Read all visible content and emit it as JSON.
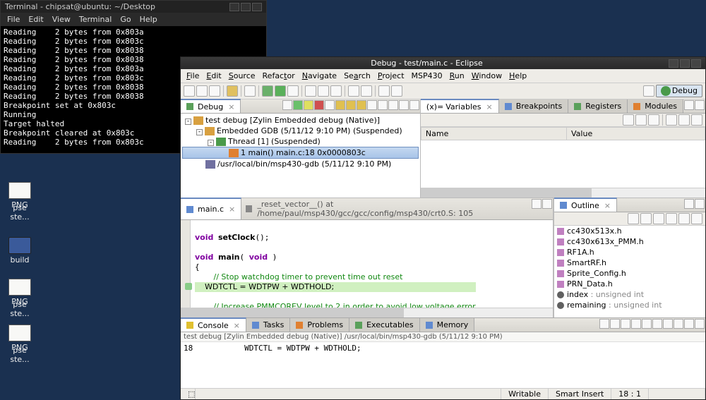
{
  "desktop_icons": [
    "PNG",
    "pse ste...",
    "build",
    "PNG",
    "pse ste...",
    "PNG",
    "pse ste..."
  ],
  "terminal": {
    "title": "Terminal - chipsat@ubuntu: ~/Desktop",
    "menu": [
      "File",
      "Edit",
      "View",
      "Terminal",
      "Go",
      "Help"
    ],
    "body": "Reading    2 bytes from 0x803a\nReading    2 bytes from 0x803c\nReading    2 bytes from 0x8038\nReading    2 bytes from 0x8038\nReading    2 bytes from 0x803a\nReading    2 bytes from 0x803c\nReading    2 bytes from 0x8038\nReading    2 bytes from 0x8038\nBreakpoint set at 0x803c\nRunning\nTarget halted\nBreakpoint cleared at 0x803c\nReading    2 bytes from 0x803c"
  },
  "eclipse": {
    "title": "Debug - test/main.c - Eclipse",
    "menu": [
      "File",
      "Edit",
      "Source",
      "Refactor",
      "Navigate",
      "Search",
      "Project",
      "MSP430",
      "Run",
      "Window",
      "Help"
    ],
    "perspective": "Debug",
    "debug_view": {
      "tab": "Debug",
      "tree": [
        {
          "l": 0,
          "exp": "-",
          "cls": "icn",
          "txt": "test debug [Zylin Embedded debug (Native)]"
        },
        {
          "l": 1,
          "exp": "-",
          "cls": "icn",
          "txt": "Embedded GDB (5/11/12 9:10 PM) (Suspended)"
        },
        {
          "l": 2,
          "exp": "-",
          "cls": "icn thr",
          "txt": "Thread [1] (Suspended)"
        },
        {
          "l": 3,
          "exp": "",
          "cls": "icn frm",
          "txt": "1 main() main.c:18 0x0000803c",
          "sel": true
        },
        {
          "l": 1,
          "exp": "",
          "cls": "icn exe",
          "txt": "/usr/local/bin/msp430-gdb (5/11/12 9:10 PM)"
        }
      ]
    },
    "vars_view": {
      "tabs": [
        "Variables",
        "Breakpoints",
        "Registers",
        "Modules"
      ],
      "cols": [
        "Name",
        "Value"
      ]
    },
    "editor": {
      "tab": "main.c",
      "crumb": "_reset_vector__()  at  /home/paul/msp430/gcc/gcc/config/msp430/crt0.S: 105"
    },
    "outline": {
      "tab": "Outline",
      "items": [
        {
          "t": "h",
          "n": "cc430x513x.h"
        },
        {
          "t": "h",
          "n": "cc430x613x_PMM.h"
        },
        {
          "t": "h",
          "n": "RF1A.h"
        },
        {
          "t": "h",
          "n": "SmartRF.h"
        },
        {
          "t": "h",
          "n": "Sprite_Config.h"
        },
        {
          "t": "h",
          "n": "PRN_Data.h"
        },
        {
          "t": "v",
          "n": "index",
          "ty": ": unsigned int"
        },
        {
          "t": "v",
          "n": "remaining",
          "ty": ": unsigned int"
        }
      ]
    },
    "console": {
      "tabs": [
        "Console",
        "Tasks",
        "Problems",
        "Executables",
        "Memory"
      ],
      "hdr": "test debug [Zylin Embedded debug (Native)] /usr/local/bin/msp430-gdb (5/11/12 9:10 PM)",
      "txt": "18           WDTCTL = WDTPW + WDTHOLD;"
    },
    "status": {
      "writable": "Writable",
      "insert": "Smart Insert",
      "pos": "18 : 1"
    }
  }
}
